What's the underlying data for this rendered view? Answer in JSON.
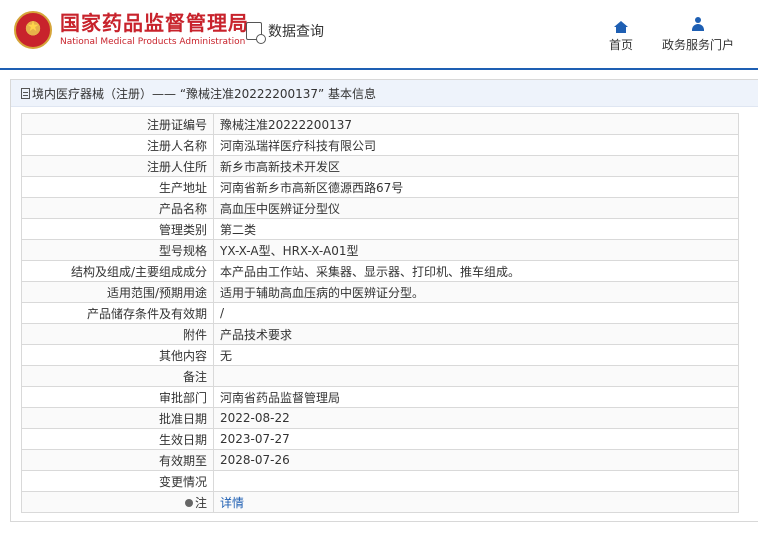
{
  "header": {
    "org_cn": "国家药品监督管理局",
    "org_en": "National Medical Products Administration",
    "query_label": "数据查询",
    "nav": [
      {
        "label": "首页",
        "icon": "home-icon"
      },
      {
        "label": "政务服务门户",
        "icon": "user-icon"
      }
    ]
  },
  "panel": {
    "title": "境内医疗器械（注册）—— “豫械注准20222200137” 基本信息",
    "rows": [
      {
        "key": "注册证编号",
        "value": "豫械注准20222200137"
      },
      {
        "key": "注册人名称",
        "value": "河南泓瑞祥医疗科技有限公司"
      },
      {
        "key": "注册人住所",
        "value": "新乡市高新技术开发区"
      },
      {
        "key": "生产地址",
        "value": "河南省新乡市高新区德源西路67号"
      },
      {
        "key": "产品名称",
        "value": "高血压中医辨证分型仪"
      },
      {
        "key": "管理类别",
        "value": "第二类"
      },
      {
        "key": "型号规格",
        "value": "YX-X-A型、HRX-X-A01型"
      },
      {
        "key": "结构及组成/主要组成成分",
        "value": "本产品由工作站、采集器、显示器、打印机、推车组成。"
      },
      {
        "key": "适用范围/预期用途",
        "value": "适用于辅助高血压病的中医辨证分型。"
      },
      {
        "key": "产品储存条件及有效期",
        "value": "/"
      },
      {
        "key": "附件",
        "value": "产品技术要求"
      },
      {
        "key": "其他内容",
        "value": "无"
      },
      {
        "key": "备注",
        "value": ""
      },
      {
        "key": "审批部门",
        "value": "河南省药品监督管理局"
      },
      {
        "key": "批准日期",
        "value": "2022-08-22"
      },
      {
        "key": "生效日期",
        "value": "2023-07-27"
      },
      {
        "key": "有效期至",
        "value": "2028-07-26"
      },
      {
        "key": "变更情况",
        "value": ""
      }
    ],
    "note_key": "注",
    "note_link": "详情"
  },
  "colors": {
    "brand_red": "#c8232c",
    "brand_blue": "#1e5fb3"
  }
}
